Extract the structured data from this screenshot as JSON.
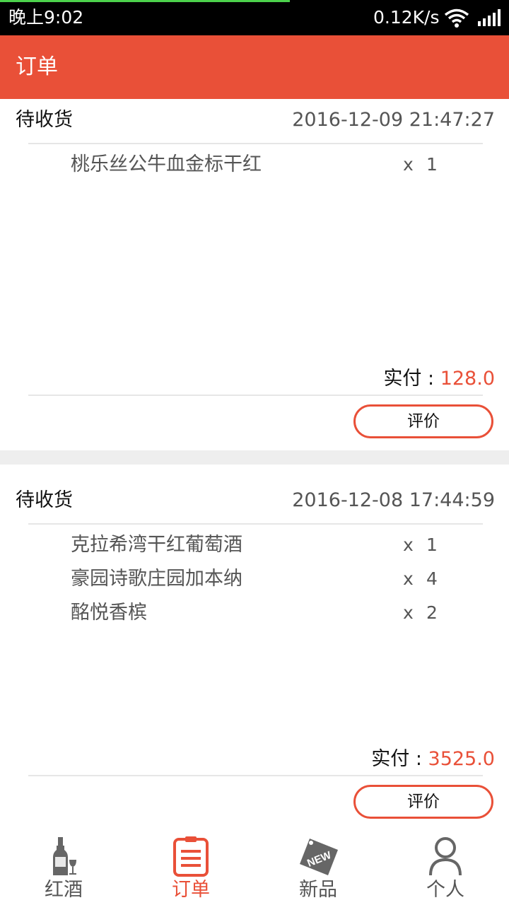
{
  "status_bar": {
    "time": "晚上9:02",
    "net_speed": "0.12K/s",
    "wifi_icon": "wifi-icon",
    "signal_icon": "signal-icon"
  },
  "app_bar": {
    "title": "订单"
  },
  "orders": [
    {
      "status": "待收货",
      "time": "2016-12-09 21:47:27",
      "items": [
        {
          "name": "桃乐丝公牛血金标干红",
          "x": "x",
          "qty": "1"
        }
      ],
      "paid_label": "实付 : ",
      "paid_value": "128.0",
      "review_label": "评价"
    },
    {
      "status": "待收货",
      "time": "2016-12-08 17:44:59",
      "items": [
        {
          "name": "克拉希湾干红葡萄酒",
          "x": "x",
          "qty": "1"
        },
        {
          "name": "豪园诗歌庄园加本纳",
          "x": "x",
          "qty": "4"
        },
        {
          "name": "酩悦香槟",
          "x": "x",
          "qty": "2"
        }
      ],
      "paid_label": "实付 : ",
      "paid_value": "3525.0",
      "review_label": "评价"
    }
  ],
  "tabs": [
    {
      "label": "红酒",
      "icon": "wine-bottle-icon",
      "active": false
    },
    {
      "label": "订单",
      "icon": "order-clipboard-icon",
      "active": true
    },
    {
      "label": "新品",
      "icon": "new-tag-icon",
      "active": false
    },
    {
      "label": "个人",
      "icon": "person-icon",
      "active": false
    }
  ],
  "colors": {
    "accent": "#e95038",
    "status_bar": "#000000",
    "tab_inactive": "#555555",
    "divider": "#e6e6e6"
  }
}
